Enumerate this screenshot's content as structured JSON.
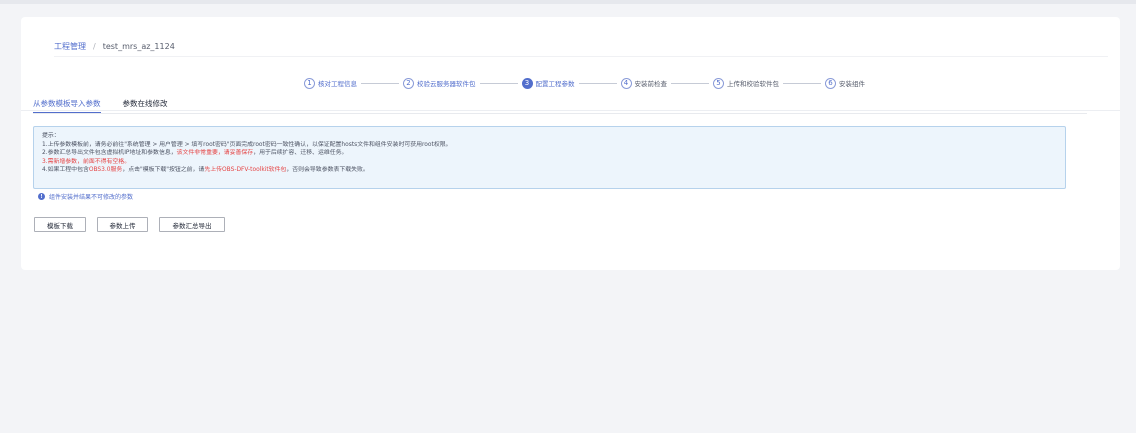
{
  "breadcrumb": {
    "root": "工程管理",
    "separator": "/",
    "current": "test_mrs_az_1124"
  },
  "steps": [
    {
      "num": "1",
      "label": "核对工程信息",
      "state": "done"
    },
    {
      "num": "2",
      "label": "校验云服务器软件包",
      "state": "done"
    },
    {
      "num": "3",
      "label": "配置工程参数",
      "state": "active"
    },
    {
      "num": "4",
      "label": "安装前检查",
      "state": "pending"
    },
    {
      "num": "5",
      "label": "上传和校验软件包",
      "state": "pending"
    },
    {
      "num": "6",
      "label": "安装组件",
      "state": "pending"
    }
  ],
  "tabs": [
    {
      "label": "从参数模板导入参数",
      "active": true
    },
    {
      "label": "参数在线修改",
      "active": false
    }
  ],
  "notice": {
    "title": "提示：",
    "line1": "1.上传参数模板前，请务必前往\"系统管理 > 用户管理 > 填写root密码\"页面完成root密码一致性确认，以保证配置hosts文件和组件安装时可获用root权限。",
    "line2_a": "2.参数汇总导出文件包含虚拟机IP地址和参数信息，",
    "line2_red": "该文件非常重要，请妥善保存",
    "line2_b": "，用于后续扩容、迁移、运维任务。",
    "line3_red": "3.需新增参数，前面不得有空格。",
    "line4_a": "4.如果工程中包含",
    "line4_red1": "OBS3.0服务",
    "line4_b": "，点击\"模板下载\"按钮之前，请",
    "line4_red2": "先上传OBS-DFV-toolkit软件包",
    "line4_c": "，否则会导致参数表下载失败。"
  },
  "hint": {
    "icon": "info-icon",
    "text": "组件安装并结果不可修改的参数"
  },
  "buttons": {
    "download": "模板下载",
    "upload": "参数上传",
    "export": "参数汇总导出"
  },
  "colors": {
    "accent": "#526ecc",
    "warning_text": "#e54545",
    "notice_bg": "#edf5fc"
  }
}
